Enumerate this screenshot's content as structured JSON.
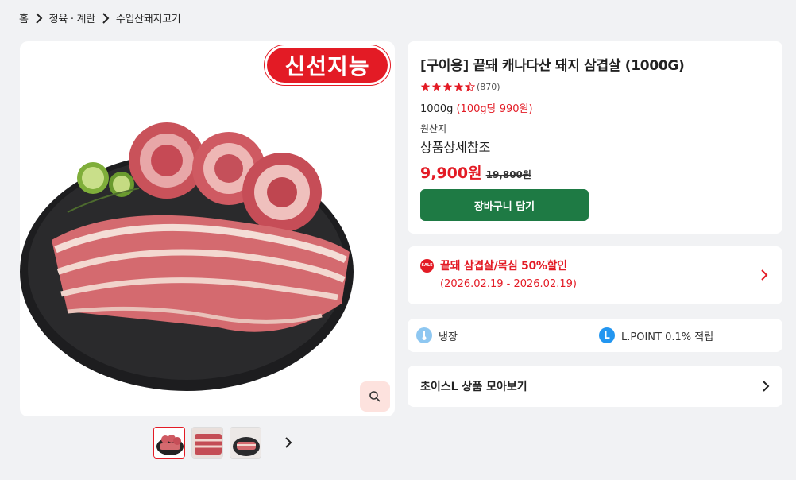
{
  "breadcrumb": {
    "items": [
      "홈",
      "정육 · 계란",
      "수입산돼지고기"
    ]
  },
  "gallery": {
    "badge": "신선지능",
    "thumbnails": [
      "thumb-1",
      "thumb-2",
      "thumb-3"
    ],
    "active_thumbnail": 0
  },
  "product": {
    "title": "[구이용] 끝돼 캐나다산 돼지 삼겹살 (1000G)",
    "rating": 4.5,
    "rating_count": "(870)",
    "weight": "1000g",
    "unit_price": "(100g당 990원)",
    "origin_label": "원산지",
    "origin_value": "상품상세참조",
    "sale_price": "9,900원",
    "original_price": "19,800원",
    "cart_button": "장바구니 담기"
  },
  "promotion": {
    "icon_text": "SALE",
    "title": "끝돼 삼겹살/목심 50%할인",
    "period": "(2026.02.19 - 2026.02.19)"
  },
  "features": {
    "storage": "냉장",
    "lpoint_icon": "L",
    "lpoint": "L.POINT 0.1% 적립"
  },
  "choice": {
    "label": "초이스L 상품 모아보기"
  },
  "colors": {
    "accent_red": "#e31b25",
    "cart_green": "#1e7a44",
    "lpoint_blue": "#2396f0"
  }
}
